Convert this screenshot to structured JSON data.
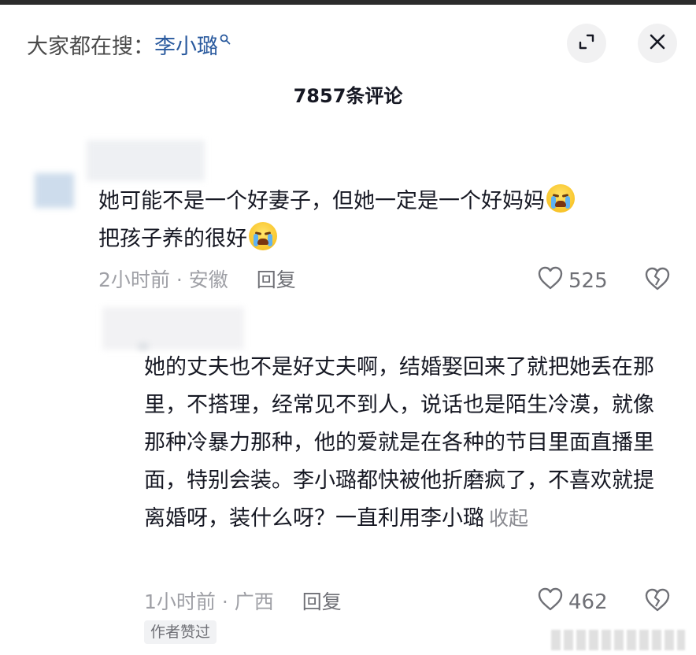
{
  "header": {
    "search_prefix": "大家都在搜：",
    "search_term": "李小璐",
    "search_icon": "search-icon",
    "expand_icon": "expand-icon",
    "close_icon": "close-icon"
  },
  "comment_count": "7857条评论",
  "comments": [
    {
      "text_line1": "她可能不是一个好妻子，但她一定是一个好妈妈",
      "text_line2": "把孩子养的很好",
      "emoji": "crying-face-icon",
      "time_location": "2小时前 · 安徽",
      "reply_label": "回复",
      "likes": "525"
    },
    {
      "text": "她的丈夫也不是好丈夫啊，结婚娶回来了就把她丢在那里，不搭理，经常见不到人，说话也是陌生冷漠，就像那种冷暴力那种，他的爱就是在各种的节目里面直播里面，特别会装。李小璐都快被他折磨疯了，不喜欢就提离婚呀，装什么呀？一直利用李小璐",
      "collapse_label": "收起",
      "time_location": "1小时前 · 广西",
      "reply_label": "回复",
      "likes": "462",
      "author_badge": "作者赞过"
    }
  ],
  "colors": {
    "link_blue": "#2a5a9e",
    "text_primary": "#161823",
    "text_secondary": "#9fa0a6"
  }
}
